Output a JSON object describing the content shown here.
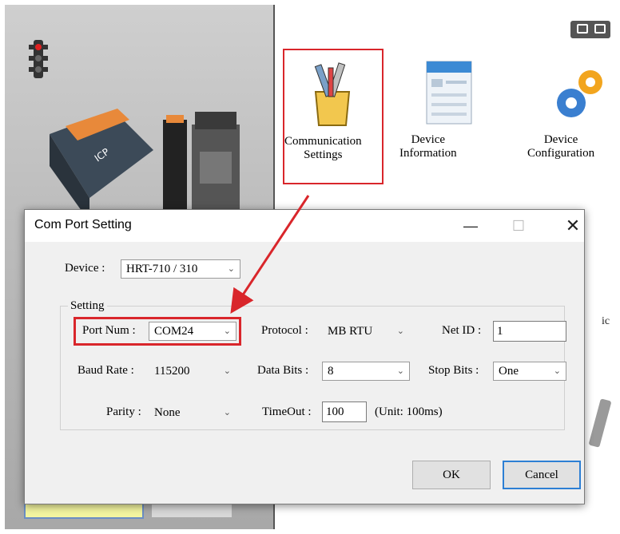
{
  "app": {
    "tools": [
      {
        "label": "Communication\nSettings",
        "icon": "communication-settings-icon"
      },
      {
        "label": "Device\nInformation",
        "icon": "device-information-icon"
      },
      {
        "label": "Device\nConfiguration",
        "icon": "device-configuration-icon"
      }
    ],
    "side_text": "ic"
  },
  "dialog": {
    "title": "Com Port Setting",
    "minimize": "—",
    "maximize": "☐",
    "close": "✕",
    "device_label": "Device :",
    "device_value": "HRT-710 / 310",
    "setting_group": "Setting",
    "port_num_label": "Port Num :",
    "port_num_value": "COM24",
    "protocol_label": "Protocol :",
    "protocol_value": "MB RTU",
    "net_id_label": "Net ID :",
    "net_id_value": "1",
    "baud_rate_label": "Baud Rate :",
    "baud_rate_value": "115200",
    "data_bits_label": "Data Bits :",
    "data_bits_value": "8",
    "stop_bits_label": "Stop Bits :",
    "stop_bits_value": "One",
    "parity_label": "Parity :",
    "parity_value": "None",
    "timeout_label": "TimeOut :",
    "timeout_value": "100",
    "timeout_unit": "(Unit: 100ms)",
    "ok_label": "OK",
    "cancel_label": "Cancel"
  },
  "colors": {
    "highlight": "#d9262b",
    "focus": "#2d7fd4"
  }
}
